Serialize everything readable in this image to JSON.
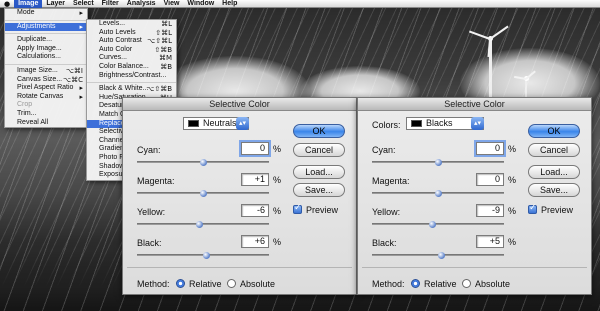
{
  "menubar": {
    "items": [
      "Image",
      "Layer",
      "Select",
      "Filter",
      "Analysis",
      "View",
      "Window",
      "Help"
    ],
    "selected": "Image"
  },
  "image_menu": {
    "items": [
      {
        "label": "Mode",
        "sub": true
      },
      {
        "sep": true
      },
      {
        "label": "Adjustments",
        "sub": true,
        "highlight": true
      },
      {
        "sep": true
      },
      {
        "label": "Duplicate..."
      },
      {
        "label": "Apply Image..."
      },
      {
        "label": "Calculations..."
      },
      {
        "sep": true
      },
      {
        "label": "Image Size...",
        "shortcut": "⌥⌘I"
      },
      {
        "label": "Canvas Size...",
        "shortcut": "⌥⌘C"
      },
      {
        "label": "Pixel Aspect Ratio",
        "sub": true
      },
      {
        "label": "Rotate Canvas",
        "sub": true
      },
      {
        "label": "Crop",
        "disabled": true
      },
      {
        "label": "Trim..."
      },
      {
        "label": "Reveal All"
      }
    ]
  },
  "adjust_menu": {
    "items": [
      {
        "label": "Levels...",
        "shortcut": "⌘L"
      },
      {
        "label": "Auto Levels",
        "shortcut": "⇧⌘L"
      },
      {
        "label": "Auto Contrast",
        "shortcut": "⌥⇧⌘L"
      },
      {
        "label": "Auto Color",
        "shortcut": "⇧⌘B"
      },
      {
        "label": "Curves...",
        "shortcut": "⌘M"
      },
      {
        "label": "Color Balance...",
        "shortcut": "⌘B"
      },
      {
        "label": "Brightness/Contrast..."
      },
      {
        "sep": true
      },
      {
        "label": "Black & White...",
        "shortcut": "⌥⇧⌘B"
      },
      {
        "label": "Hue/Saturation...",
        "shortcut": "⌘U"
      },
      {
        "label": "Desaturate",
        "shortcut": "⇧⌘U"
      },
      {
        "label": "Match Color..."
      },
      {
        "label": "Replace Color...",
        "highlight": true
      },
      {
        "label": "Selective Color..."
      },
      {
        "label": "Channel Mixer..."
      },
      {
        "label": "Gradient Map..."
      },
      {
        "label": "Photo Filter..."
      },
      {
        "label": "Shadow/Highlight..."
      },
      {
        "label": "Exposure..."
      }
    ]
  },
  "dialog_left": {
    "title": "Selective Color",
    "colors_value": "Neutrals",
    "rows": [
      {
        "label": "Cyan:",
        "value": "0",
        "level": 0.5,
        "focused": true
      },
      {
        "label": "Magenta:",
        "value": "+1",
        "level": 0.505
      },
      {
        "label": "Yellow:",
        "value": "-6",
        "level": 0.47
      },
      {
        "label": "Black:",
        "value": "+6",
        "level": 0.53
      }
    ],
    "pct": "%",
    "buttons": {
      "ok": "OK",
      "cancel": "Cancel",
      "load": "Load...",
      "save": "Save..."
    },
    "preview": "Preview",
    "method": {
      "label": "Method:",
      "relative": "Relative",
      "absolute": "Absolute",
      "selected": "Relative"
    }
  },
  "dialog_right": {
    "title": "Selective Color",
    "colors_label": "Colors:",
    "colors_value": "Blacks",
    "rows": [
      {
        "label": "Cyan:",
        "value": "0",
        "level": 0.5,
        "focused": true
      },
      {
        "label": "Magenta:",
        "value": "0",
        "level": 0.5
      },
      {
        "label": "Yellow:",
        "value": "-9",
        "level": 0.455
      },
      {
        "label": "Black:",
        "value": "+5",
        "level": 0.525
      }
    ],
    "pct": "%",
    "buttons": {
      "ok": "OK",
      "cancel": "Cancel",
      "load": "Load...",
      "save": "Save..."
    },
    "preview": "Preview",
    "method": {
      "label": "Method:",
      "relative": "Relative",
      "absolute": "Absolute",
      "selected": "Relative"
    }
  },
  "colors": {
    "accent": "#3d6fd9",
    "menu_bg": "#f6f6f6",
    "dialog_bg": "#e4e4e4"
  }
}
